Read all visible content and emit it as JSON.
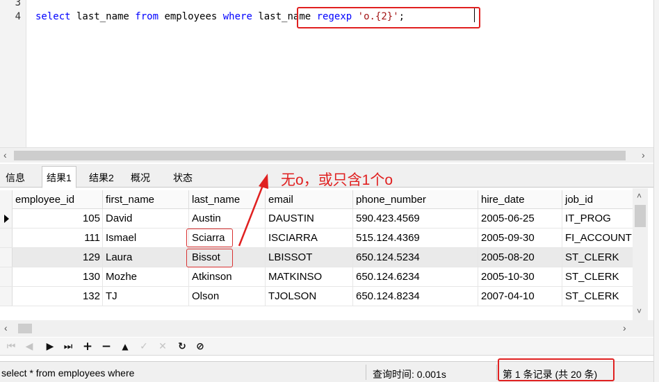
{
  "editor": {
    "lines": [
      {
        "number": "3",
        "code": ""
      },
      {
        "number": "4",
        "code": "select last_name from employees where last_name regexp 'o.{2}';"
      }
    ],
    "tokens": {
      "select": "select",
      "last_name_1": " last_name ",
      "from": "from",
      "employees": " employees ",
      "where": "where",
      "space": " ",
      "last_name_2": "last_name ",
      "regexp": "regexp",
      "space2": " ",
      "pattern": "'o.{2}'",
      "semicolon": ";"
    }
  },
  "tabs": [
    {
      "label": "信息",
      "active": false
    },
    {
      "label": "结果1",
      "active": true
    },
    {
      "label": "结果2",
      "active": false
    },
    {
      "label": "概况",
      "active": false
    },
    {
      "label": "状态",
      "active": false
    }
  ],
  "annotation": "无o，或只含1个o",
  "grid": {
    "columns": [
      "employee_id",
      "first_name",
      "last_name",
      "email",
      "phone_number",
      "hire_date",
      "job_id"
    ],
    "rows": [
      [
        "105",
        "David",
        "Austin",
        "DAUSTIN",
        "590.423.4569",
        "2005-06-25",
        "IT_PROG"
      ],
      [
        "111",
        "Ismael",
        "Sciarra",
        "ISCIARRA",
        "515.124.4369",
        "2005-09-30",
        "FI_ACCOUNT"
      ],
      [
        "129",
        "Laura",
        "Bissot",
        "LBISSOT",
        "650.124.5234",
        "2005-08-20",
        "ST_CLERK"
      ],
      [
        "130",
        "Mozhe",
        "Atkinson",
        "MATKINSO",
        "650.124.6234",
        "2005-10-30",
        "ST_CLERK"
      ],
      [
        "132",
        "TJ",
        "Olson",
        "TJOLSON",
        "650.124.8234",
        "2007-04-10",
        "ST_CLERK"
      ]
    ],
    "current_row": 0,
    "selected_row": 2
  },
  "navbar": {
    "first": "⏮",
    "prev": "◀",
    "next": "▶",
    "last": "⏭",
    "add": "+",
    "delete": "−",
    "up": "▲",
    "apply": "✓",
    "discard": "✕",
    "refresh": "↻",
    "stop": "⊘"
  },
  "status": {
    "query": "select * from employees where",
    "time": "查询时间: 0.001s",
    "records": "第 1 条记录 (共 20 条)"
  },
  "colors": {
    "keyword": "#0000ff",
    "string": "#a31515",
    "annotation_red": "#e02020"
  }
}
